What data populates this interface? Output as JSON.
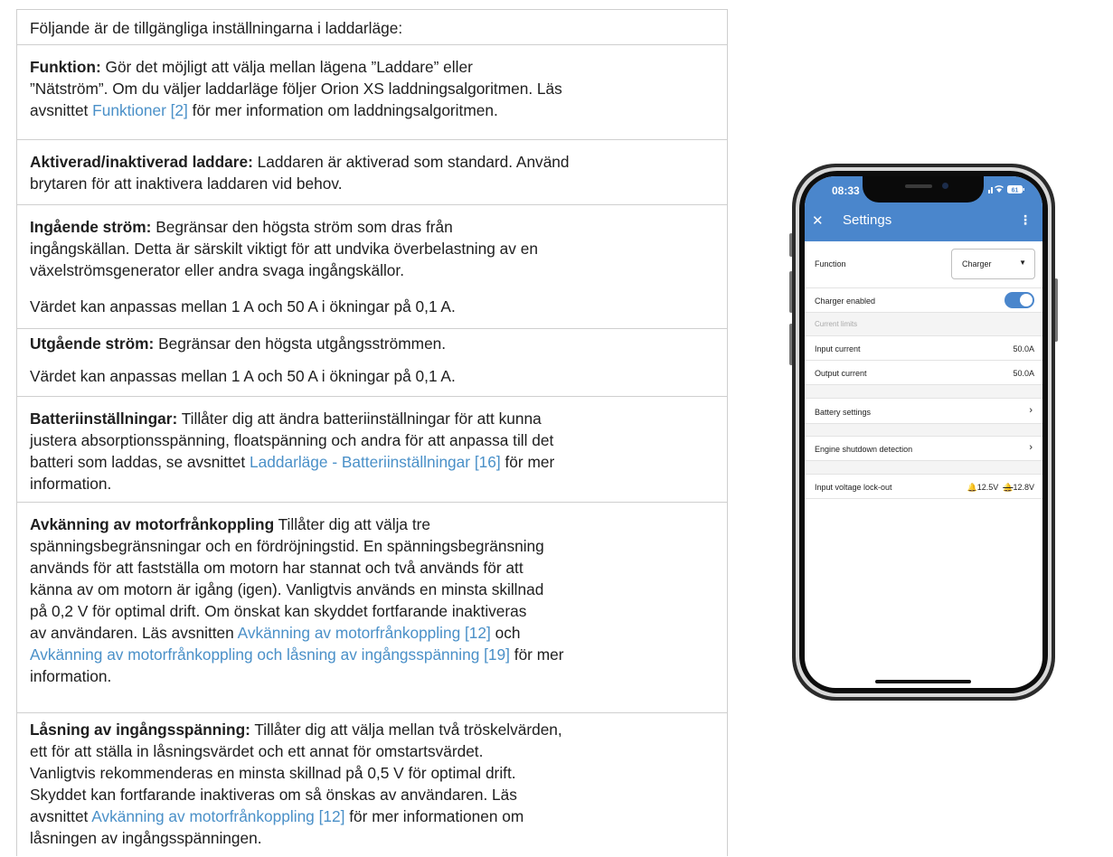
{
  "doc": {
    "intro": "Följande är de tillgängliga inställningarna i laddarläge:",
    "function": {
      "bold": "Funktion:",
      "l1": " Gör det möjligt att välja mellan lägena ”Laddare” eller",
      "l2": "”Nätström”. Om du väljer laddarläge följer Orion XS laddningsalgoritmen. Läs",
      "l3a": "avsnittet ",
      "l3link": "Funktioner [2]",
      "l3b": " för mer information om laddningsalgoritmen."
    },
    "charger": {
      "bold": "Aktiverad/inaktiverad laddare:",
      "l1": " Laddaren är aktiverad som standard. Använd",
      "l2": "brytaren för att inaktivera laddaren vid behov."
    },
    "input_current": {
      "bold": "Ingående ström:",
      "l1": " Begränsar den högsta ström som dras från",
      "l2": "ingångskällan. Detta är särskilt viktigt för att undvika överbelastning av en",
      "l3": "växelströmsgenerator eller andra svaga ingångskällor.",
      "note": "Värdet kan anpassas mellan 1 A och 50 A i ökningar på 0,1 A."
    },
    "output_current": {
      "bold": "Utgående ström:",
      "l1": " Begränsar den högsta utgångsströmmen.",
      "note": "Värdet kan anpassas mellan 1 A och 50 A i ökningar på 0,1 A."
    },
    "battery": {
      "bold": "Batteriinställningar:",
      "l1": " Tillåter dig att ändra batteriinställningar för att kunna",
      "l2": "justera absorptionsspänning, floatspänning och andra för att anpassa till det",
      "l3a": "batteri som laddas, se avsnittet ",
      "l3link": "Laddarläge - Batteriinställningar [16]",
      "l3b": " för mer",
      "l4": "information."
    },
    "engine": {
      "bold": "Avkänning av motorfrånkoppling",
      "l1": " Tillåter dig att välja tre",
      "l2": "spänningsbegränsningar och en fördröjningstid. En spänningsbegränsning",
      "l3": "används för att fastställa om motorn har stannat och två används för att",
      "l4": "känna av om motorn är igång (igen). Vanligtvis används en minsta skillnad",
      "l5": "på 0,2 V för optimal drift. Om önskat kan skyddet fortfarande inaktiveras",
      "l6a": "av användaren. Läs avsnitten ",
      "l6link": "Avkänning av motorfrånkoppling [12]",
      "l6b": " och",
      "l7link": "Avkänning av motorfrånkoppling och låsning av ingångsspänning [19]",
      "l7b": " för mer",
      "l8": "information."
    },
    "lockout": {
      "bold": "Låsning av ingångsspänning:",
      "l1": " Tillåter dig att välja mellan två tröskelvärden,",
      "l2": "ett för att ställa in låsningsvärdet och ett annat för omstartsvärdet.",
      "l3": "Vanligtvis rekommenderas en minsta skillnad på 0,5 V för optimal drift.",
      "l4": "Skyddet kan fortfarande inaktiveras om så önskas av användaren. Läs",
      "l5a": "avsnittet ",
      "l5link": "Avkänning av motorfrånkoppling [12]",
      "l5b": " för mer informationen om",
      "l6": "låsningen av ingångsspänningen."
    }
  },
  "phone": {
    "status_time": "08:33",
    "title": "Settings",
    "function_label": "Function",
    "function_value": "Charger",
    "charger_enabled_label": "Charger enabled",
    "charger_enabled": true,
    "section_current_limits": "Current limits",
    "input_current_label": "Input current",
    "input_current_value": "50.0A",
    "output_current_label": "Output current",
    "output_current_value": "50.0A",
    "battery_settings_label": "Battery settings",
    "engine_shutdown_label": "Engine shutdown detection",
    "lockout_label": "Input voltage lock-out",
    "lockout_on": "12.5V",
    "lockout_off": "12.8V"
  },
  "colors": {
    "link": "#4a90c8",
    "accent": "#4a86cc"
  }
}
